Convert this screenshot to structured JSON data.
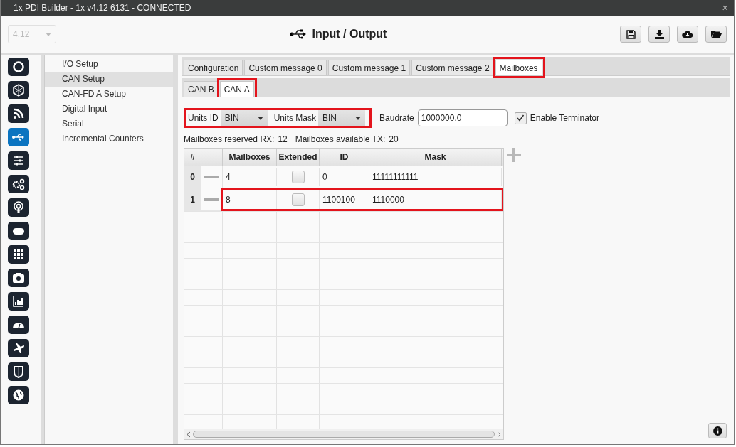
{
  "window": {
    "title": "1x PDI Builder - 1x v4.12 6131 - CONNECTED",
    "controls": [
      "—",
      "✕"
    ]
  },
  "header": {
    "version": "4.12",
    "title": "Input / Output"
  },
  "nav_icons": [
    {
      "selected": false
    },
    {
      "selected": false
    },
    {
      "selected": false
    },
    {
      "selected": true
    },
    {
      "selected": false
    },
    {
      "selected": false
    },
    {
      "selected": false
    },
    {
      "selected": false
    },
    {
      "selected": false
    },
    {
      "selected": false
    },
    {
      "selected": false
    },
    {
      "selected": false
    },
    {
      "selected": false
    },
    {
      "selected": false
    },
    {
      "selected": false
    }
  ],
  "sidebar": {
    "items": [
      {
        "label": "I/O Setup",
        "selected": false
      },
      {
        "label": "CAN Setup",
        "selected": true
      },
      {
        "label": "CAN-FD A Setup",
        "selected": false
      },
      {
        "label": "Digital Input",
        "selected": false
      },
      {
        "label": "Serial",
        "selected": false
      },
      {
        "label": "Incremental Counters",
        "selected": false
      }
    ]
  },
  "tabs": [
    {
      "label": "Configuration",
      "selected": false,
      "highlighted": false
    },
    {
      "label": "Custom message 0",
      "selected": false,
      "highlighted": false
    },
    {
      "label": "Custom message 1",
      "selected": false,
      "highlighted": false
    },
    {
      "label": "Custom message 2",
      "selected": false,
      "highlighted": false
    },
    {
      "label": "Mailboxes",
      "selected": true,
      "highlighted": true
    }
  ],
  "subtabs": [
    {
      "label": "CAN B",
      "selected": false,
      "highlighted": false
    },
    {
      "label": "CAN A",
      "selected": true,
      "highlighted": true
    }
  ],
  "units": {
    "highlighted": true,
    "id_label": "Units ID",
    "id_value": "BIN",
    "mask_label": "Units Mask",
    "mask_value": "BIN"
  },
  "baudrate": {
    "label": "Baudrate",
    "value": "1000000.0",
    "spin": "--"
  },
  "terminator": {
    "label": "Enable Terminator",
    "checked": true
  },
  "summary": {
    "rx_label": "Mailboxes reserved RX:",
    "rx_value": "12",
    "tx_label": "Mailboxes available TX:",
    "tx_value": "20"
  },
  "table": {
    "columns": [
      "#",
      "Mailboxes",
      "Extended",
      "ID",
      "Mask"
    ],
    "rows": [
      {
        "index": "0",
        "mailboxes": "4",
        "extended": false,
        "id": "0",
        "mask": "11111111111",
        "highlighted": false
      },
      {
        "index": "1",
        "mailboxes": "8",
        "extended": false,
        "id": "1100100",
        "mask": "1110000",
        "highlighted": true
      }
    ]
  }
}
